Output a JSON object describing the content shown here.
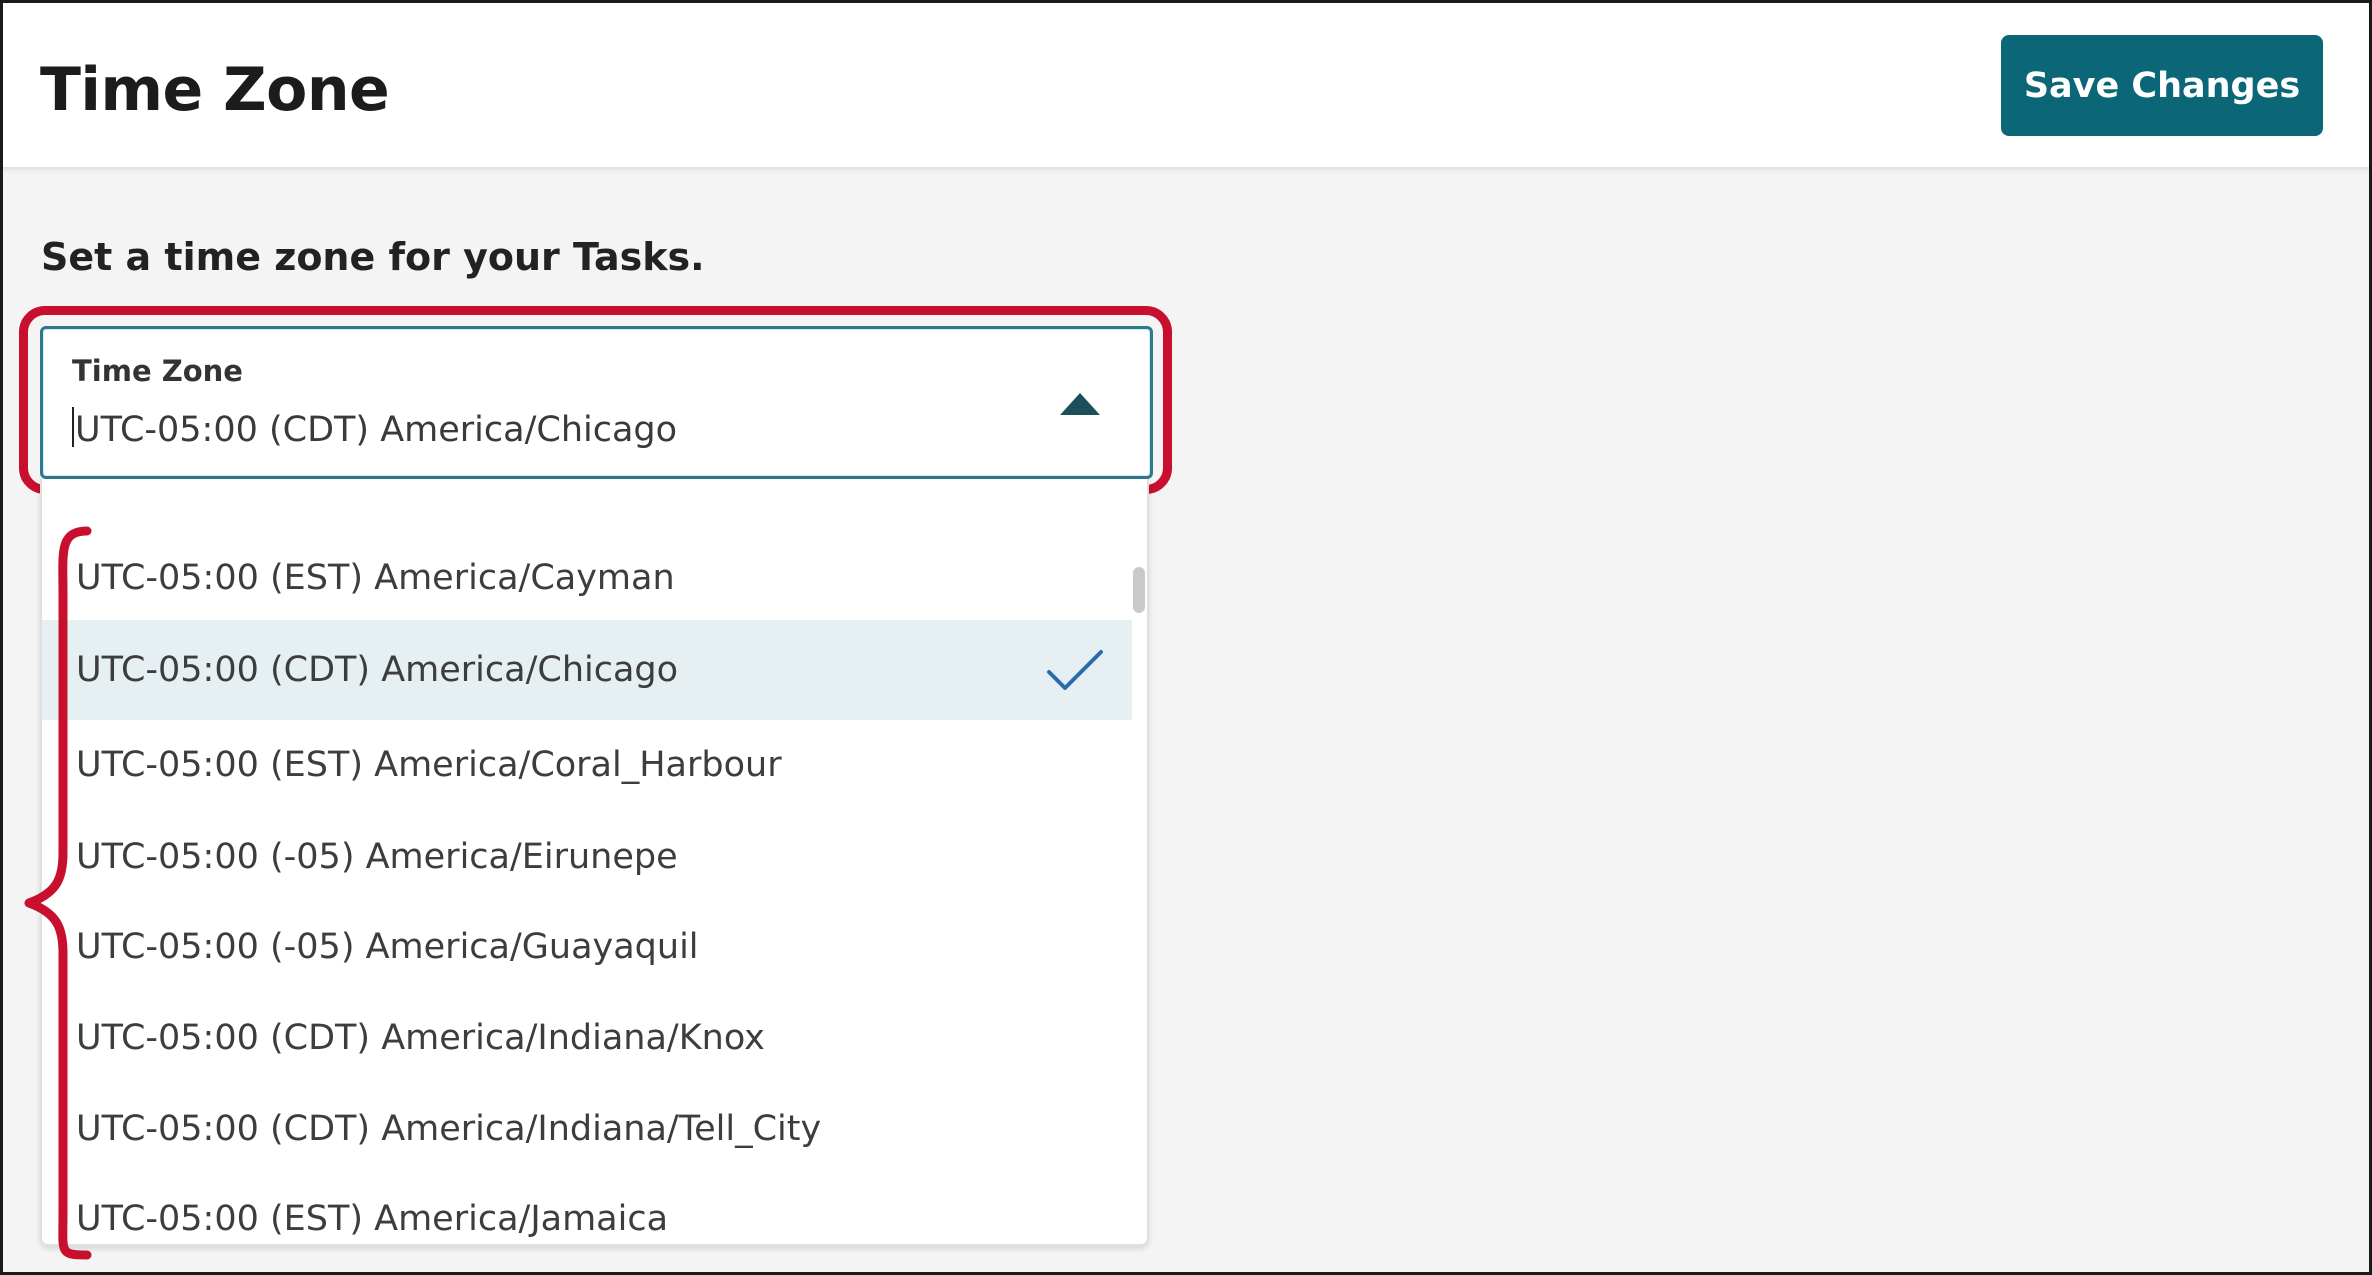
{
  "header": {
    "title": "Time Zone",
    "save_label": "Save Changes"
  },
  "instruction": "Set a time zone for your Tasks.",
  "timezone_select": {
    "label": "Time Zone",
    "value": "UTC-05:00 (CDT) America/Chicago",
    "expanded": true,
    "icon": "chevron-up-icon"
  },
  "dropdown": {
    "options": [
      {
        "label": "UTC-05:00 (EST) America/Cayman",
        "selected": false
      },
      {
        "label": "UTC-05:00 (CDT) America/Chicago",
        "selected": true
      },
      {
        "label": "UTC-05:00 (EST) America/Coral_Harbour",
        "selected": false
      },
      {
        "label": "UTC-05:00 (-05) America/Eirunepe",
        "selected": false
      },
      {
        "label": "UTC-05:00 (-05) America/Guayaquil",
        "selected": false
      },
      {
        "label": "UTC-05:00 (CDT) America/Indiana/Knox",
        "selected": false
      },
      {
        "label": "UTC-05:00 (CDT) America/Indiana/Tell_City",
        "selected": false
      },
      {
        "label": "UTC-05:00 (EST) America/Jamaica",
        "selected": false
      }
    ],
    "selected_icon": "check-icon"
  },
  "colors": {
    "accent": "#0b6677",
    "highlight_annotation": "#c8102e",
    "selected_row": "#e6f0f3",
    "check": "#2a6cae"
  }
}
